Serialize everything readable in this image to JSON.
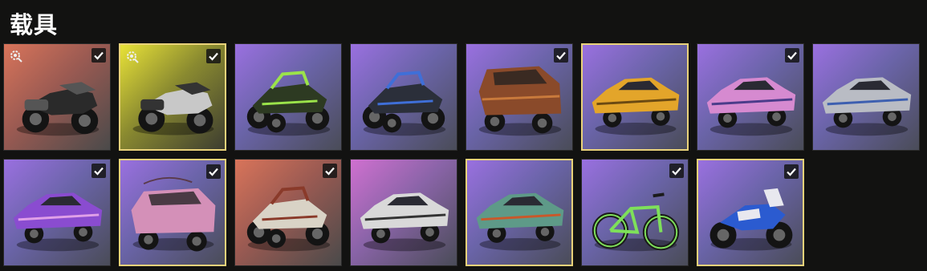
{
  "page": {
    "title": "载具"
  },
  "colors": {
    "selected_border": "#e9d27a",
    "check": "#ffffff",
    "background": "#121211"
  },
  "tiles": [
    {
      "name": "motorcycle-black",
      "bg": "orange",
      "vehicle": "motorcycle",
      "body": "#2a2a2a",
      "accent": "#555555",
      "checked": true,
      "selected": false,
      "customizable": true
    },
    {
      "name": "motorcycle-silver",
      "bg": "yellow",
      "vehicle": "motorcycle",
      "body": "#c8c8c8",
      "accent": "#333333",
      "checked": true,
      "selected": true,
      "customizable": true
    },
    {
      "name": "buggy-green",
      "bg": "purple",
      "vehicle": "buggy",
      "body": "#2d3a22",
      "accent": "#9be34a",
      "checked": false,
      "selected": false,
      "customizable": false
    },
    {
      "name": "buggy-blue",
      "bg": "purple",
      "vehicle": "buggy",
      "body": "#2b2f3a",
      "accent": "#3f6fd8",
      "checked": false,
      "selected": false,
      "customizable": false
    },
    {
      "name": "suv-rust",
      "bg": "purple",
      "vehicle": "suv",
      "body": "#8a4a2a",
      "accent": "#c97a3c",
      "checked": true,
      "selected": false,
      "customizable": false
    },
    {
      "name": "sedan-yellow",
      "bg": "purple",
      "vehicle": "sedan",
      "body": "#e3a52a",
      "accent": "#6b4a12",
      "checked": false,
      "selected": true,
      "customizable": false
    },
    {
      "name": "coupe-pink",
      "bg": "purple",
      "vehicle": "coupe",
      "body": "#d68ad0",
      "accent": "#4b3c8a",
      "checked": true,
      "selected": false,
      "customizable": false
    },
    {
      "name": "sedan-silver",
      "bg": "purple",
      "vehicle": "sedan",
      "body": "#b9bcc4",
      "accent": "#3d5fb0",
      "checked": false,
      "selected": false,
      "customizable": false
    },
    {
      "name": "sedan-purple",
      "bg": "purple",
      "vehicle": "sedan",
      "body": "#8a4cd0",
      "accent": "#e0a0e8",
      "checked": true,
      "selected": false,
      "customizable": false
    },
    {
      "name": "armored-pink",
      "bg": "purple",
      "vehicle": "armored",
      "body": "#d490b8",
      "accent": "#5a3a4a",
      "checked": true,
      "selected": true,
      "customizable": false
    },
    {
      "name": "buggy-white",
      "bg": "orange",
      "vehicle": "buggy",
      "body": "#d9d3c6",
      "accent": "#8a3a2a",
      "checked": true,
      "selected": false,
      "customizable": false
    },
    {
      "name": "sedan-white",
      "bg": "pink",
      "vehicle": "sedan",
      "body": "#d9d9d9",
      "accent": "#333333",
      "checked": false,
      "selected": false,
      "customizable": false
    },
    {
      "name": "sedan-teal",
      "bg": "purple",
      "vehicle": "sedan",
      "body": "#5e9a88",
      "accent": "#c9582a",
      "checked": false,
      "selected": true,
      "customizable": false
    },
    {
      "name": "bicycle-green",
      "bg": "purple",
      "vehicle": "bicycle",
      "body": "#7ee05a",
      "accent": "#1b1b1b",
      "checked": true,
      "selected": false,
      "customizable": false
    },
    {
      "name": "motorcycle-blue",
      "bg": "purple",
      "vehicle": "dirtbike",
      "body": "#2b5bd0",
      "accent": "#e8e8ef",
      "checked": true,
      "selected": true,
      "customizable": false
    }
  ]
}
